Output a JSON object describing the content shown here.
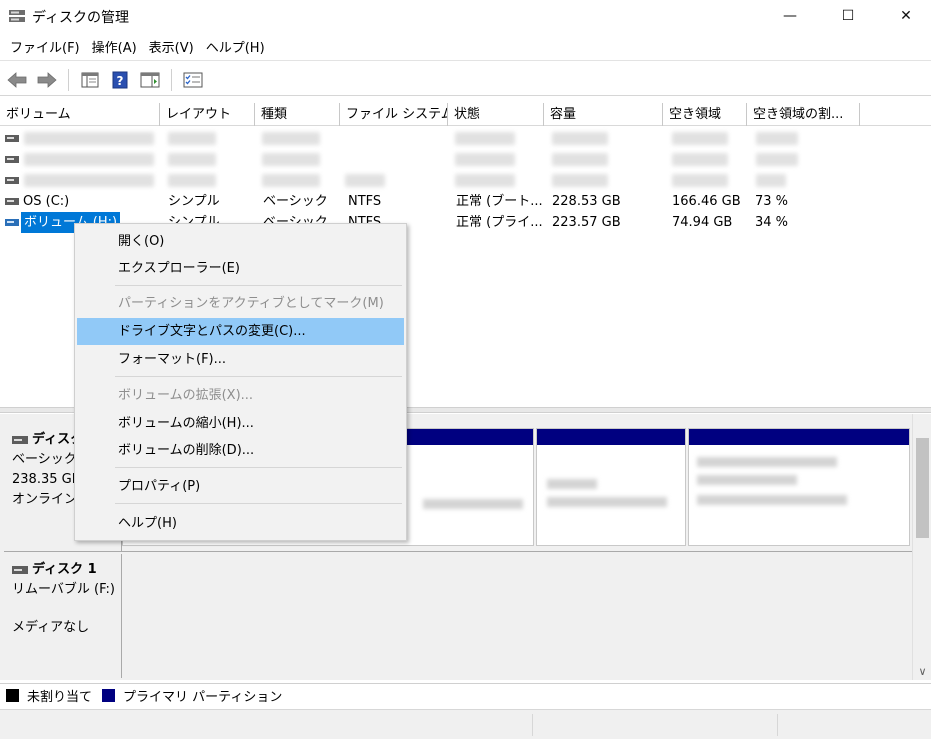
{
  "window": {
    "title": "ディスクの管理",
    "minimize_glyph": "—",
    "maximize_glyph": "☐",
    "close_glyph": "✕"
  },
  "menubar": [
    {
      "label": "ファイル(F)"
    },
    {
      "label": "操作(A)"
    },
    {
      "label": "表示(V)"
    },
    {
      "label": "ヘルプ(H)"
    }
  ],
  "toolbar": {
    "icons": [
      "back-arrow-icon",
      "forward-arrow-icon",
      "console-tree-icon",
      "help-icon",
      "properties-icon",
      "checklist-icon"
    ]
  },
  "columns": [
    "ボリューム",
    "レイアウト",
    "種類",
    "ファイル システム",
    "状態",
    "容量",
    "空き領域",
    "空き領域の割..."
  ],
  "volumes": [
    {
      "name": "OS (C:)",
      "layout": "シンプル",
      "type": "ベーシック",
      "fs": "NTFS",
      "status": "正常 (ブート...",
      "capacity": "228.53 GB",
      "free": "166.46 GB",
      "free_pct": "73 %"
    },
    {
      "name": "ボリューム (H:)",
      "layout": "シンプル",
      "type": "ベーシック",
      "fs": "NTFS",
      "status": "正常 (プライ...",
      "capacity": "223.57 GB",
      "free": "74.94 GB",
      "free_pct": "34 %"
    }
  ],
  "disks": [
    {
      "name": "ディスク",
      "type": "ベーシック",
      "size": "238.35 GE",
      "state": "オンライン"
    },
    {
      "name": "ディスク 1",
      "type": "リムーバブル (F:)",
      "state": "メディアなし"
    }
  ],
  "legend": {
    "unallocated": "未割り当て",
    "primary": "プライマリ パーティション",
    "unallocated_color": "#000000",
    "primary_color": "#000080"
  },
  "context_menu": {
    "open": "開く(O)",
    "explorer": "エクスプローラー(E)",
    "mark_active": "パーティションをアクティブとしてマーク(M)",
    "change_letter": "ドライブ文字とパスの変更(C)...",
    "format": "フォーマット(F)...",
    "extend": "ボリュームの拡張(X)...",
    "shrink": "ボリュームの縮小(H)...",
    "delete": "ボリュームの削除(D)...",
    "properties": "プロパティ(P)",
    "help": "ヘルプ(H)"
  },
  "scrollbar": {
    "down_glyph": "∨"
  },
  "colors": {
    "highlight": "#91c9f7",
    "selection": "#0078d7",
    "partition_header": "#000080"
  }
}
